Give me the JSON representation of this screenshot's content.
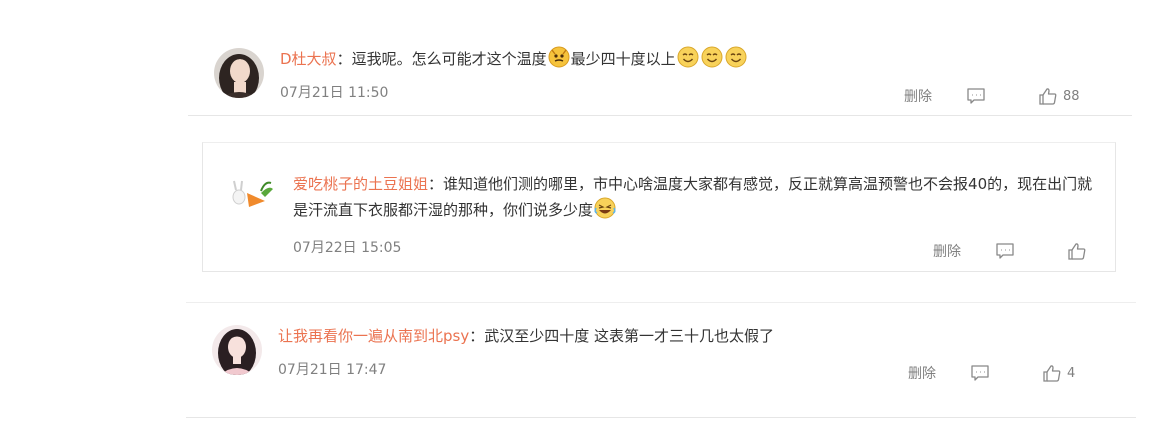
{
  "comments": [
    {
      "username": "D杜大叔",
      "separator": "：",
      "text_1": "逗我呢。怎么可能才这个温度",
      "text_2": "最少四十度以上",
      "time": "07月21日 11:50",
      "delete_label": "删除",
      "like_count": "88"
    },
    {
      "username": "爱吃桃子的土豆姐姐",
      "separator": "：",
      "text_1": "谁知道他们测的哪里，市中心啥温度大家都有感觉，反正就算高温预警也不会报",
      "text_2": "40的，现在出门就是汗流直下衣服都汗湿的那种，你们说多少度",
      "time": "07月22日 15:05",
      "delete_label": "删除",
      "like_count": ""
    },
    {
      "username": "让我再看你一遍从南到北psy",
      "separator": "：",
      "text_1": "武汉至少四十度 这表第一才三十几也太假了",
      "time": "07月21日 17:47",
      "delete_label": "删除",
      "like_count": "4"
    }
  ],
  "colors": {
    "username": "#eb7350",
    "body_text": "#333333",
    "meta_text": "#808080"
  },
  "icons": [
    "comment-icon",
    "thumbs-up-icon",
    "sly-face-emoji",
    "smile-emoji",
    "laughing-emoji"
  ]
}
